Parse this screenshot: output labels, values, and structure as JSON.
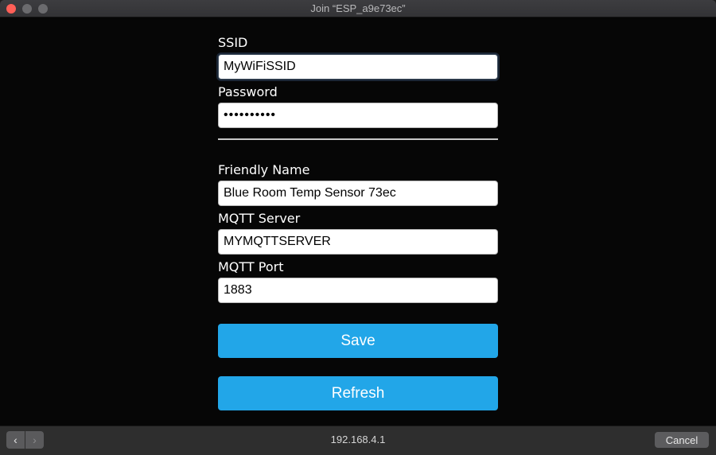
{
  "window": {
    "title": "Join “ESP_a9e73ec”"
  },
  "form": {
    "ssid": {
      "label": "SSID",
      "value": "MyWiFiSSID"
    },
    "password": {
      "label": "Password",
      "value": "••••••••••"
    },
    "friendly_name": {
      "label": "Friendly Name",
      "value": "Blue Room Temp Sensor 73ec"
    },
    "mqtt_server": {
      "label": "MQTT Server",
      "value": "MYMQTTSERVER"
    },
    "mqtt_port": {
      "label": "MQTT Port",
      "value": "1883"
    },
    "save_label": "Save",
    "refresh_label": "Refresh"
  },
  "bottombar": {
    "back_icon": "‹",
    "forward_icon": "›",
    "address": "192.168.4.1",
    "cancel_label": "Cancel"
  },
  "colors": {
    "accent": "#22a6e8",
    "close": "#ff5f57"
  }
}
